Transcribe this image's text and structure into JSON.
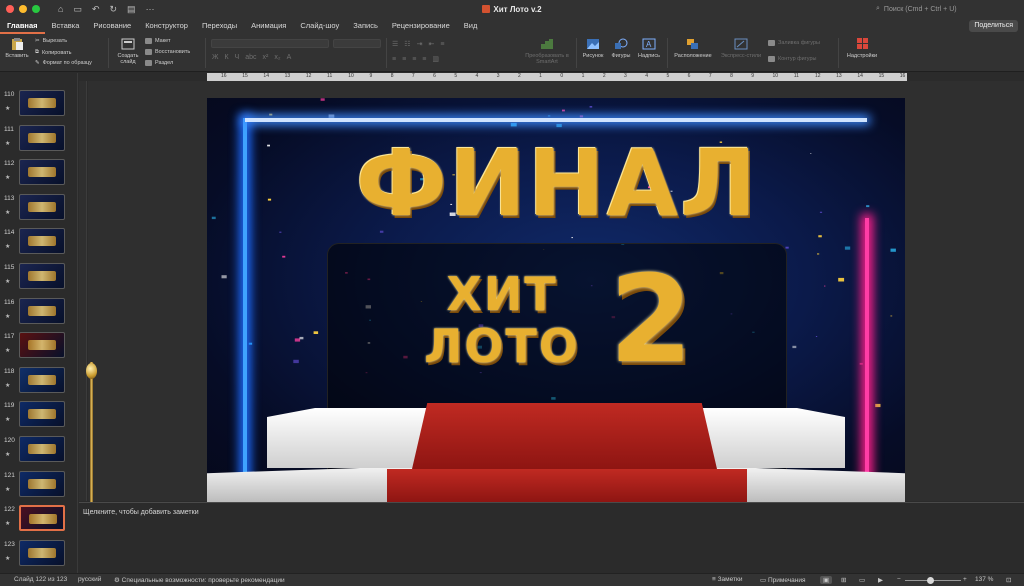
{
  "window": {
    "title": "Хит Лото v.2",
    "search_placeholder": "Поиск (Cmd + Ctrl + U)",
    "share_label": "Поделиться",
    "traffic_colors": [
      "#ff5f57",
      "#febc2e",
      "#28c840"
    ]
  },
  "tabs": [
    {
      "label": "Главная",
      "active": true
    },
    {
      "label": "Вставка"
    },
    {
      "label": "Рисование"
    },
    {
      "label": "Конструктор"
    },
    {
      "label": "Переходы"
    },
    {
      "label": "Анимация"
    },
    {
      "label": "Слайд-шоу"
    },
    {
      "label": "Запись"
    },
    {
      "label": "Рецензирование"
    },
    {
      "label": "Вид"
    }
  ],
  "ribbon": {
    "paste": "Вставить",
    "cut": "Вырезать",
    "copy": "Копировать",
    "format_painter": "Формат по образцу",
    "new_slide": "Создать слайд",
    "layout": "Макет",
    "reset": "Восстановить",
    "section": "Раздел",
    "convert_smartart": "Преобразовать в SmartArt",
    "picture": "Рисунок",
    "shapes": "Фигуры",
    "textbox": "Надпись",
    "arrange": "Расположение",
    "quick_styles": "Экспресс-стили",
    "shape_fill": "Заливка фигуры",
    "shape_outline": "Контур фигуры",
    "addins": "Надстройки",
    "accent": "#e27047"
  },
  "ruler": {
    "labels": [
      "16",
      "15",
      "14",
      "13",
      "12",
      "11",
      "10",
      "9",
      "8",
      "7",
      "6",
      "5",
      "4",
      "3",
      "2",
      "1",
      "0",
      "1",
      "2",
      "3",
      "4",
      "5",
      "6",
      "7",
      "8",
      "9",
      "10",
      "11",
      "12",
      "13",
      "14",
      "15",
      "16"
    ]
  },
  "thumbnails": [
    {
      "num": "110"
    },
    {
      "num": "111"
    },
    {
      "num": "112"
    },
    {
      "num": "113"
    },
    {
      "num": "114"
    },
    {
      "num": "115"
    },
    {
      "num": "116"
    },
    {
      "num": "117"
    },
    {
      "num": "118"
    },
    {
      "num": "119"
    },
    {
      "num": "120"
    },
    {
      "num": "121"
    },
    {
      "num": "122",
      "selected": true
    },
    {
      "num": "123"
    }
  ],
  "slide": {
    "title": "ФИНАЛ",
    "subtitle_line1": "ХИТ",
    "subtitle_line2": "ЛОТО",
    "number": "2"
  },
  "notes": {
    "placeholder": "Щелкните, чтобы добавить заметки"
  },
  "status": {
    "slide_counter": "Слайд 122 из 123",
    "language": "русский",
    "accessibility": "Специальные возможности: проверьте рекомендации",
    "notes_btn": "Заметки",
    "comments_btn": "Примечания",
    "zoom": "137 %",
    "zoom_level_percent": 45
  }
}
